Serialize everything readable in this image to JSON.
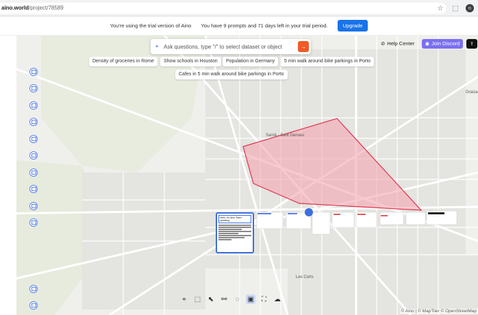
{
  "browser": {
    "url_host": "aino.world",
    "url_path": "/project/78589",
    "profile_initial": "n"
  },
  "banner": {
    "trial_text": "You're using the trial version of Aino",
    "prompts_text": "You have 9 prompts and 71 days left in your trial period.",
    "upgrade_label": "Upgrade"
  },
  "search": {
    "placeholder": "Ask questions, type \"/\" to select dataset or object"
  },
  "suggestions": [
    "Density of groceries in Rome",
    "Show schools in Houston",
    "Population in Germany",
    "5 min walk around bike parkings in Porto",
    "Cafes in 5 min walk around bike parkings in Porto"
  ],
  "topright": {
    "help_label": "Help Center",
    "discord_label": "Join Discord"
  },
  "map_labels": {
    "gracia": "Gracia",
    "sant_gervasi": "Sarrià - Sant Gervasi",
    "les_corts": "Les Corts"
  },
  "note": {
    "header": "Hello, It's Aino Team speaking"
  },
  "attribution": "© Aino | © MapTiler © OpenStreetMap",
  "colors": {
    "polygon_fill": "#f4a6b0",
    "polygon_stroke": "#e0314b",
    "accent": "#1a73e8"
  }
}
